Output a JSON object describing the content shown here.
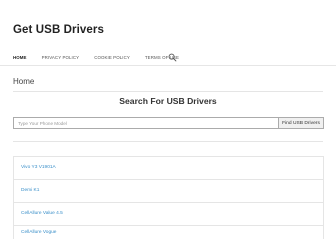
{
  "header": {
    "site_title": "Get USB Drivers",
    "nav": [
      {
        "label": "HOME"
      },
      {
        "label": "PRIVACY POLICY"
      },
      {
        "label": "COOKIE POLICY"
      },
      {
        "label": "TERMS OF USE"
      }
    ],
    "search_icon": "search-icon"
  },
  "main": {
    "page_heading": "Home",
    "search_title": "Search For USB Drivers",
    "search": {
      "placeholder": "Type Your Phone Model",
      "button_label": "Find USB Drivers"
    },
    "results": [
      {
        "label": "Vivo Y3 V1901A"
      },
      {
        "label": "Demi K1"
      },
      {
        "label": "CellAllure Value 4.5"
      },
      {
        "label": "CellAllure Vogue"
      }
    ]
  },
  "colors": {
    "link": "#3a8fc9",
    "border": "#e5e5e5",
    "text": "#333333"
  }
}
